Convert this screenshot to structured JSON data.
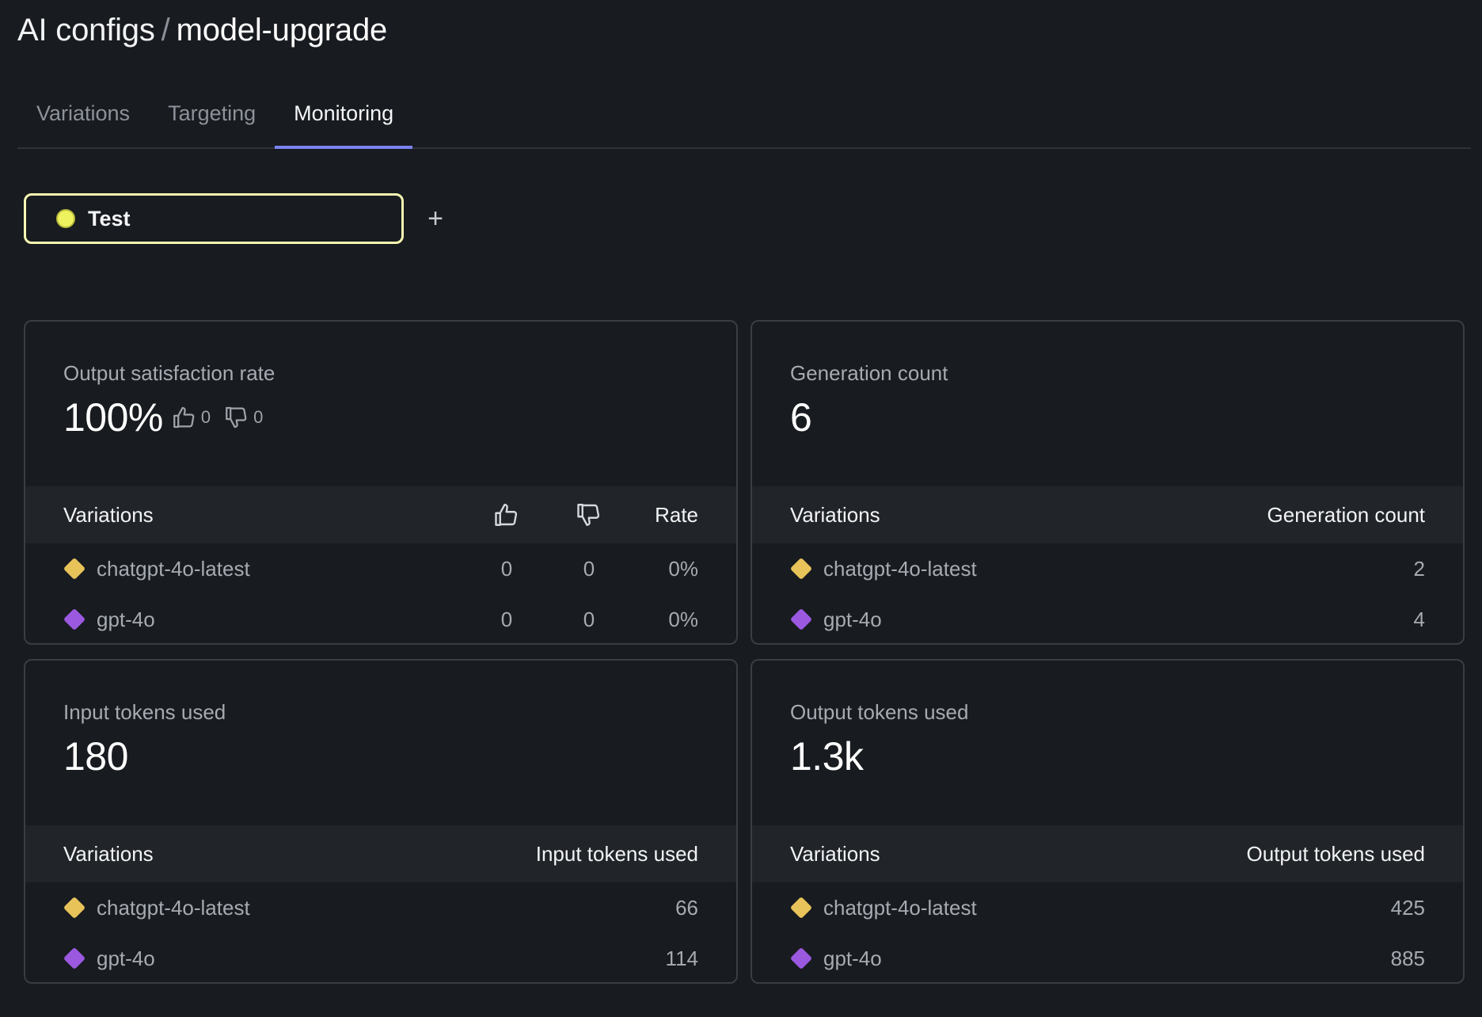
{
  "header": {
    "breadcrumb_parent": "AI configs",
    "breadcrumb_separator": "/",
    "breadcrumb_current": "model-upgrade"
  },
  "tabs": [
    {
      "label": "Variations",
      "active": false
    },
    {
      "label": "Targeting",
      "active": false
    },
    {
      "label": "Monitoring",
      "active": true
    }
  ],
  "environment": {
    "label": "Test",
    "dot_color": "#eef25e",
    "add_label": "+"
  },
  "colors": {
    "accent": "#7b83f0",
    "variation_chatgpt": "#e8c35a",
    "variation_gpt4o": "#9b59e0"
  },
  "cards": {
    "satisfaction": {
      "label": "Output satisfaction rate",
      "value": "100%",
      "thumbs_up_count": "0",
      "thumbs_down_count": "0",
      "columns": {
        "variations": "Variations",
        "thumbs_up": "thumbs-up-icon",
        "thumbs_down": "thumbs-down-icon",
        "rate": "Rate"
      },
      "rows": [
        {
          "name": "chatgpt-4o-latest",
          "color": "#e8c35a",
          "up": "0",
          "down": "0",
          "rate": "0%"
        },
        {
          "name": "gpt-4o",
          "color": "#9b59e0",
          "up": "0",
          "down": "0",
          "rate": "0%"
        }
      ]
    },
    "generation": {
      "label": "Generation count",
      "value": "6",
      "columns": {
        "variations": "Variations",
        "metric": "Generation count"
      },
      "rows": [
        {
          "name": "chatgpt-4o-latest",
          "color": "#e8c35a",
          "value": "2"
        },
        {
          "name": "gpt-4o",
          "color": "#9b59e0",
          "value": "4"
        }
      ]
    },
    "input_tokens": {
      "label": "Input tokens used",
      "value": "180",
      "columns": {
        "variations": "Variations",
        "metric": "Input tokens used"
      },
      "rows": [
        {
          "name": "chatgpt-4o-latest",
          "color": "#e8c35a",
          "value": "66"
        },
        {
          "name": "gpt-4o",
          "color": "#9b59e0",
          "value": "114"
        }
      ]
    },
    "output_tokens": {
      "label": "Output tokens used",
      "value": "1.3k",
      "columns": {
        "variations": "Variations",
        "metric": "Output tokens used"
      },
      "rows": [
        {
          "name": "chatgpt-4o-latest",
          "color": "#e8c35a",
          "value": "425"
        },
        {
          "name": "gpt-4o",
          "color": "#9b59e0",
          "value": "885"
        }
      ]
    }
  }
}
